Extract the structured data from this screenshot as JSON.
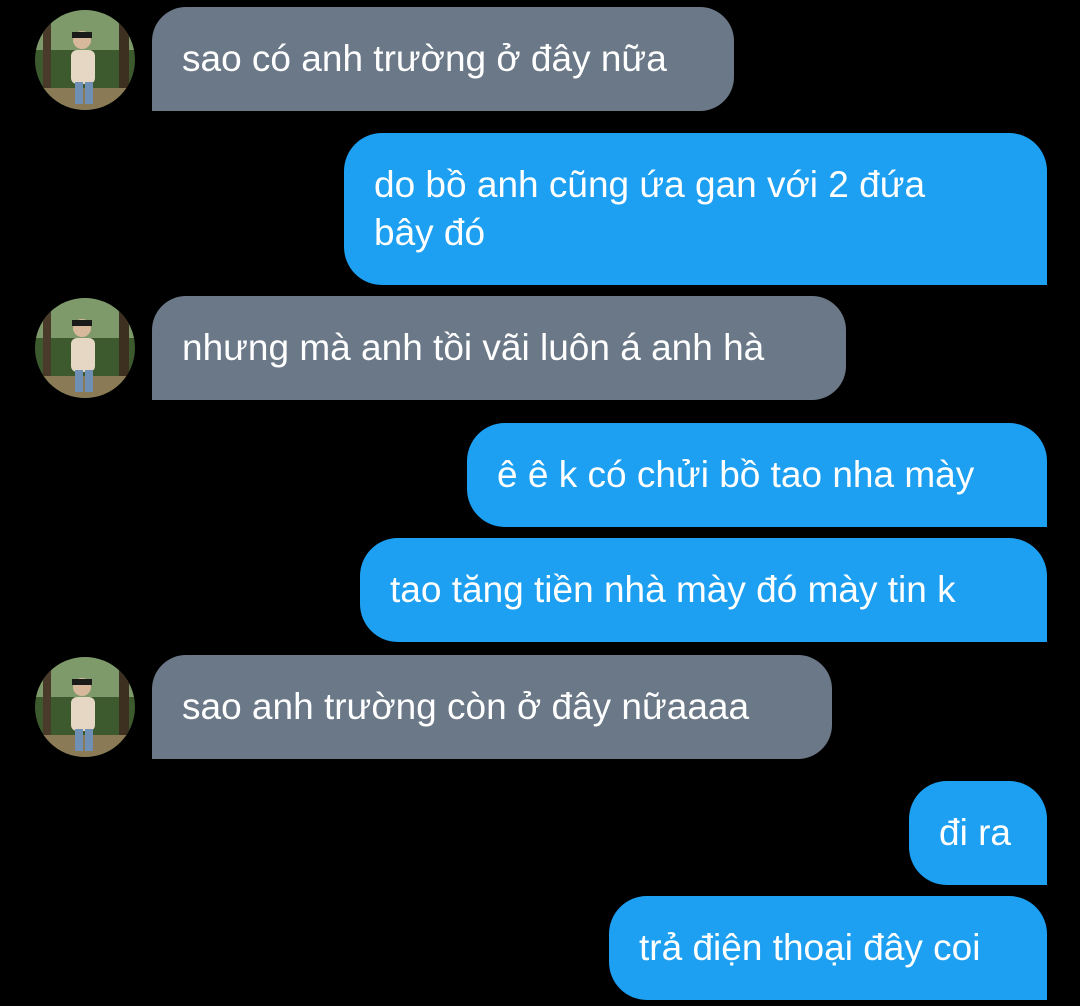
{
  "colors": {
    "background": "#000000",
    "received_bubble": "#6a7887",
    "sent_bubble": "#1da0f2",
    "text": "#ffffff"
  },
  "contact": {
    "avatar_icon": "profile-photo-avatar"
  },
  "messages": [
    {
      "direction": "received",
      "text": "sao có anh trường ở đây nữa"
    },
    {
      "direction": "sent",
      "text": "do bồ anh cũng ứa gan với 2 đứa\nbây đó"
    },
    {
      "direction": "received",
      "text": "nhưng mà anh tồi vãi luôn á anh hà"
    },
    {
      "direction": "sent",
      "text": "ê ê k có chửi bồ tao nha mày"
    },
    {
      "direction": "sent",
      "text": "tao tăng tiền nhà mày đó mày tin k"
    },
    {
      "direction": "received",
      "text": "sao anh trường còn ở đây nữaaaa"
    },
    {
      "direction": "sent",
      "text": "đi ra"
    },
    {
      "direction": "sent",
      "text": "trả điện thoại đây coi"
    }
  ]
}
